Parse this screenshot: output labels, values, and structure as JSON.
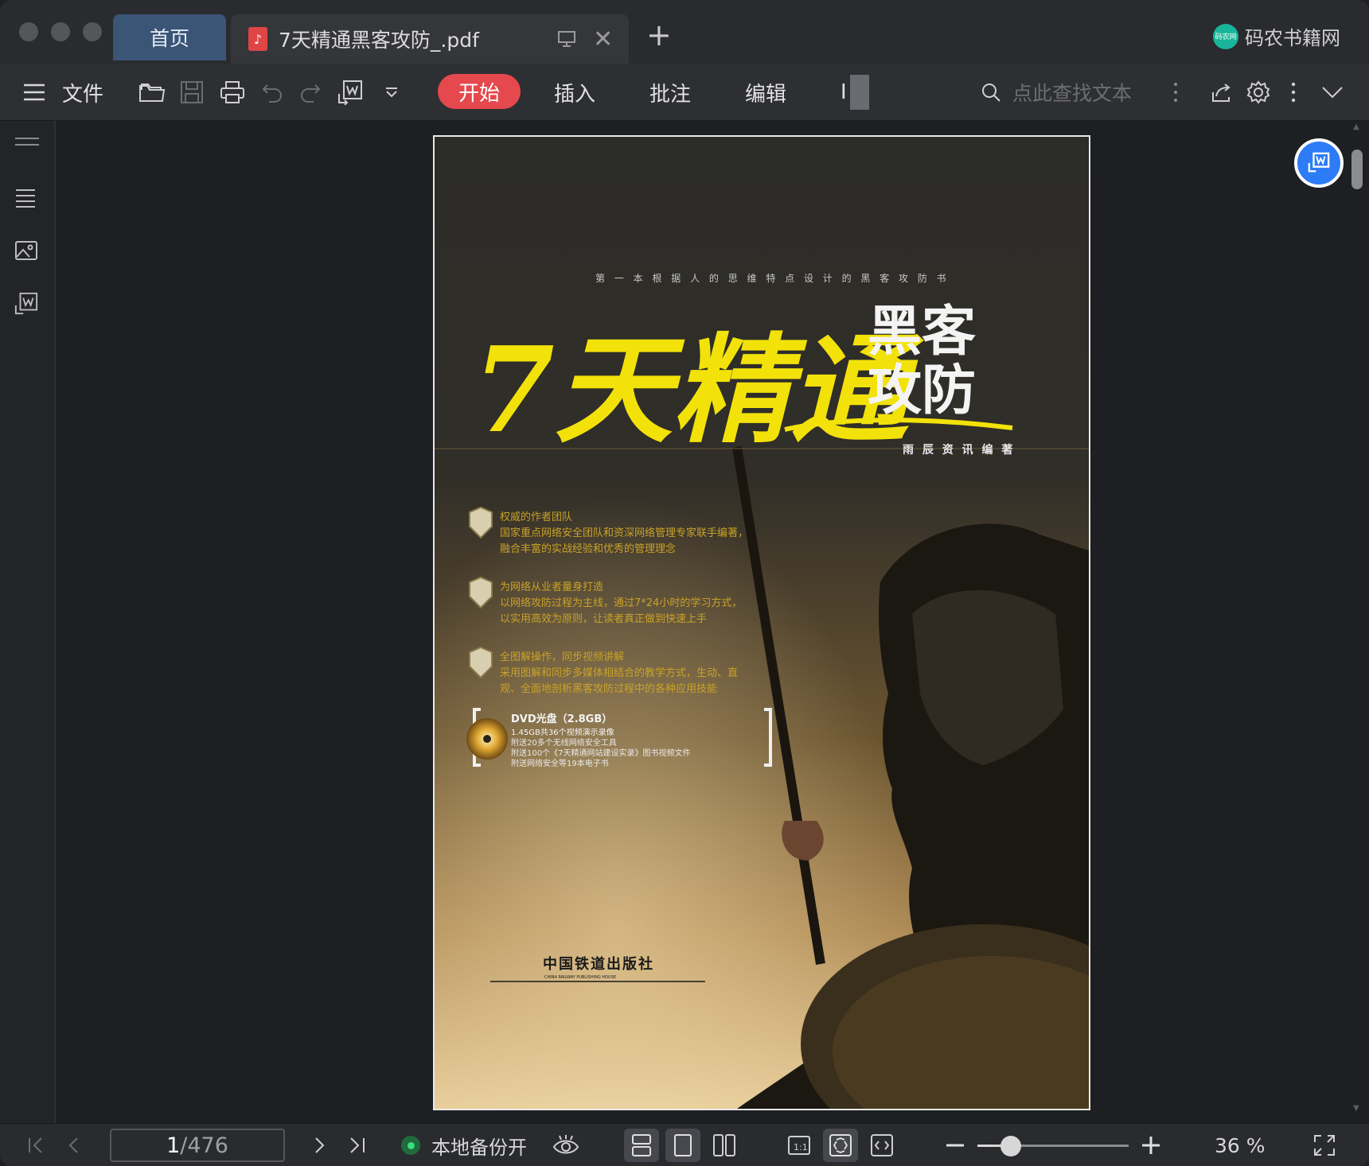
{
  "tabs": {
    "home_label": "首页",
    "doc_label": "7天精通黑客攻防_.pdf"
  },
  "brand": {
    "name": "码农书籍网",
    "logo_text": "码农网"
  },
  "toolbar": {
    "menu_label": "文件",
    "tabs": [
      "开始",
      "插入",
      "批注",
      "编辑",
      "I"
    ],
    "search_placeholder": "点此查找文本"
  },
  "colors": {
    "accent_red": "#e5484d",
    "accent_blue": "#2d7cf6",
    "tab_blue": "#3b5577"
  },
  "document": {
    "cover": {
      "tagline": "第 一 本 根 据 人 的 思 维 特 点 设 计 的 黑 客 攻 防 书",
      "title_main": "7天精通",
      "title_side_1": "黑客",
      "title_side_2": "攻防",
      "author": "雨 辰 资 讯 编 著",
      "features": [
        {
          "head": "权威的作者团队",
          "body1": "国家重点网络安全团队和资深网络管理专家联手编著，",
          "body2": "融合丰富的实战经验和优秀的管理理念"
        },
        {
          "head": "为网络从业者量身打造",
          "body1": "以网络攻防过程为主线，通过7*24小时的学习方式，",
          "body2": "以实用高效为原则，让读者真正做到快速上手"
        },
        {
          "head": "全图解操作，同步视频讲解",
          "body1": "采用图解和同步多媒体相结合的教学方式，生动、直",
          "body2": "观、全面地剖析黑客攻防过程中的各种应用技能"
        }
      ],
      "dvd": {
        "title": "DVD光盘（2.8GB）",
        "lines": [
          "1.45GB共36个视频演示录像",
          "附送20多个无线网络安全工具",
          "附送100个《7天精通网站建设实录》图书视频文件",
          "附送网络安全等19本电子书"
        ]
      },
      "publisher": "中国铁道出版社",
      "publisher_en": "CHINA RAILWAY PUBLISHING HOUSE"
    }
  },
  "statusbar": {
    "current_page": "1",
    "total_pages": "/476",
    "backup_label": "本地备份开",
    "zoom": "36 %",
    "zoom_fraction": 0.22
  }
}
